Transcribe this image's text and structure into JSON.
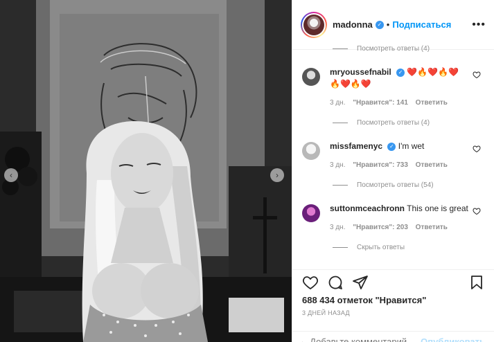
{
  "post": {
    "author": "madonna",
    "follow_label": "Подписаться",
    "more_label": "•••",
    "separator": "•"
  },
  "icons": {
    "verified": "verified-badge-icon",
    "more": "more-options-icon",
    "prev": "chevron-left-icon",
    "next": "chevron-right-icon",
    "heart": "heart-icon",
    "comment": "comment-icon",
    "share": "share-icon",
    "bookmark": "bookmark-icon",
    "emoji": "emoji-icon"
  },
  "comments": {
    "thread_top": {
      "view_replies": "Посмотреть ответы (4)"
    },
    "items": [
      {
        "user": "mryoussefnabil",
        "text": "❤️🔥❤️🔥❤️🔥❤️🔥❤️",
        "time": "3 дн.",
        "likes": "\"Нравится\": 141",
        "reply": "Ответить",
        "view_replies": "Посмотреть ответы (4)"
      },
      {
        "user": "missfamenyc",
        "text": "I'm wet",
        "time": "3 дн.",
        "likes": "\"Нравится\": 733",
        "reply": "Ответить",
        "view_replies": "Посмотреть ответы (54)"
      },
      {
        "user": "suttonmceachronn",
        "text": "This one is great",
        "time": "3 дн.",
        "likes": "\"Нравится\": 203",
        "reply": "Ответить",
        "view_replies": "Скрыть ответы"
      }
    ]
  },
  "footer": {
    "likes_count": "688 434 отметок \"Нравится\"",
    "time_ago": "3 ДНЕЙ НАЗАД",
    "comment_placeholder": "Добавьте комментарий...",
    "publish_label": "Опубликовать"
  },
  "colors": {
    "accent": "#0095f6",
    "verified": "#3897f0",
    "muted": "#8e8e8e",
    "publish_disabled": "#b2dffc"
  }
}
